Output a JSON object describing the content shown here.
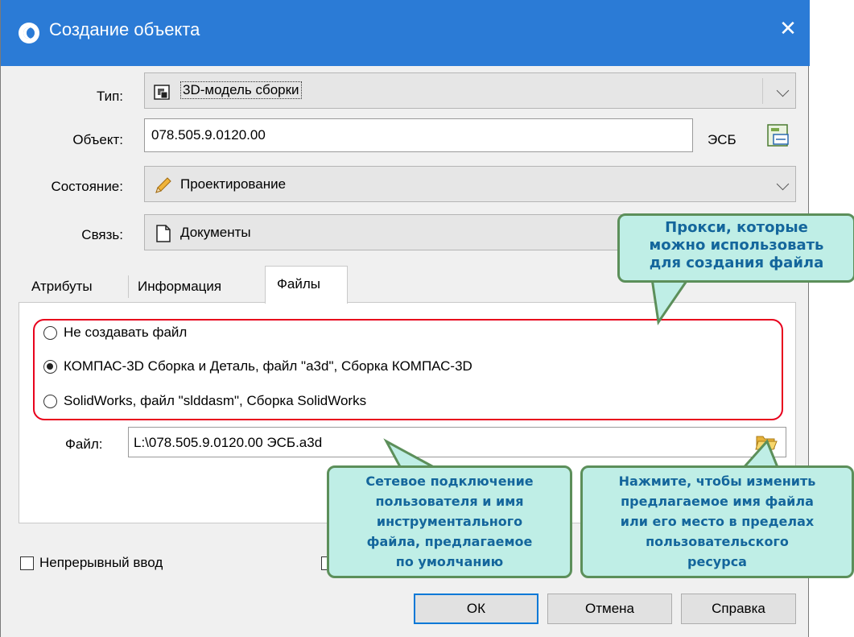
{
  "window": {
    "title": "Создание объекта",
    "close": "✕"
  },
  "fields": {
    "type_label": "Тип:",
    "type_value": "3D-модель сборки",
    "object_label": "Объект:",
    "object_value": "078.505.9.0120.00",
    "object_suffix": "ЭСБ",
    "state_label": "Состояние:",
    "state_value": "Проектирование",
    "link_label": "Связь:",
    "link_value": "Документы"
  },
  "tabs": [
    {
      "label": "Атрибуты"
    },
    {
      "label": "Информация"
    },
    {
      "label": "Файлы"
    }
  ],
  "files": {
    "options": [
      {
        "label": "Не создавать файл",
        "selected": false
      },
      {
        "label": "КОМПАС-3D Сборка и Деталь, файл \"a3d\", Сборка КОМПАС-3D",
        "selected": true
      },
      {
        "label": "SolidWorks, файл \"slddasm\", Сборка SolidWorks",
        "selected": false
      }
    ],
    "file_label": "Файл:",
    "file_value": "L:\\078.505.9.0120.00 ЭСБ.a3d"
  },
  "continuous_label": "Непрерывный ввод",
  "buttons": {
    "ok": "ОК",
    "cancel": "Отмена",
    "help": "Справка"
  },
  "callouts": {
    "proxy": [
      "Прокси, которые",
      "можно использовать",
      "для создания файла"
    ],
    "network": [
      "Сетевое подключение",
      "пользователя и имя",
      "инструментального",
      "файла, предлагаемое",
      "по умолчанию"
    ],
    "browse": [
      "Нажмите, чтобы изменить",
      "предлагаемое имя файла",
      "или его место в пределах",
      "пользовательского",
      "ресурса"
    ]
  },
  "colors": {
    "titlebar": "#2b7bd6",
    "highlight": "#e8001c",
    "callout_fill": "#bfeee6",
    "callout_text": "#14669c"
  }
}
